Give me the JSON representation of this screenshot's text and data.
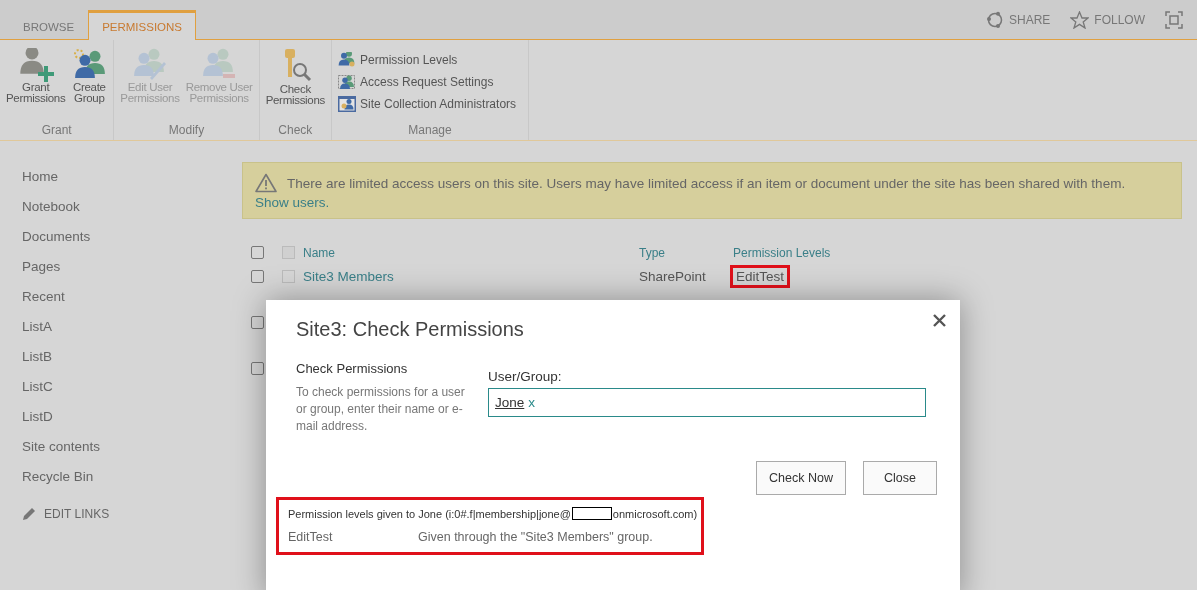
{
  "ribbon_tabs": [
    {
      "label": "BROWSE",
      "selected": false
    },
    {
      "label": "PERMISSIONS",
      "selected": true
    }
  ],
  "top_actions": [
    {
      "kind": "share",
      "label": "SHARE"
    },
    {
      "kind": "follow",
      "label": "FOLLOW"
    },
    {
      "kind": "focus"
    }
  ],
  "ribbon_groups": [
    {
      "label": "Grant",
      "buttons": [
        {
          "kind": "grant",
          "label": "Grant\nPermissions",
          "disabled": false
        },
        {
          "kind": "create",
          "label": "Create\nGroup",
          "disabled": false
        }
      ]
    },
    {
      "label": "Modify",
      "buttons": [
        {
          "kind": "edit",
          "label": "Edit User\nPermissions",
          "disabled": true
        },
        {
          "kind": "remove",
          "label": "Remove User\nPermissions",
          "disabled": true
        }
      ]
    },
    {
      "label": "Check",
      "buttons": [
        {
          "kind": "check",
          "label": "Check\nPermissions",
          "disabled": false
        }
      ]
    },
    {
      "label": "Manage",
      "small_buttons": [
        {
          "kind": "levels",
          "label": "Permission Levels"
        },
        {
          "kind": "access",
          "label": "Access Request Settings"
        },
        {
          "kind": "admins",
          "label": "Site Collection Administrators"
        }
      ]
    }
  ],
  "sidebar": {
    "items": [
      "Home",
      "Notebook",
      "Documents",
      "Pages",
      "Recent",
      "ListA",
      "ListB",
      "ListC",
      "ListD",
      "Site contents",
      "Recycle Bin"
    ],
    "edit_links": "EDIT LINKS"
  },
  "warning": {
    "text": "There are limited access users on this site. Users may have limited access if an item or document under the site has been shared with them.",
    "link": "Show users."
  },
  "table": {
    "select_all_checked": false,
    "header_item_checked": false,
    "columns": [
      "Name",
      "Type",
      "Permission Levels"
    ],
    "rows": [
      {
        "checked": false,
        "item_checked": false,
        "name": "Site3 Members",
        "type": "SharePoint",
        "permission_levels": "EditTest",
        "highlighted": true
      },
      {
        "checked": false
      },
      {
        "checked": false
      }
    ]
  },
  "dialog": {
    "title": "Site3: Check Permissions",
    "section_title": "Check Permissions",
    "description": "To check permissions for a user or group, enter their name or e-mail address.",
    "field_label": "User/Group:",
    "value": "Jone",
    "remove_mark": "x",
    "buttons": [
      "Check Now",
      "Close"
    ],
    "result": {
      "highlighted": true,
      "heading_start": "Permission levels given to Jone (i:0#.f|membership|jone@",
      "heading_end": "onmicrosoft.com)",
      "level": "EditTest",
      "reason": "Given through the \"Site3 Members\" group."
    }
  }
}
